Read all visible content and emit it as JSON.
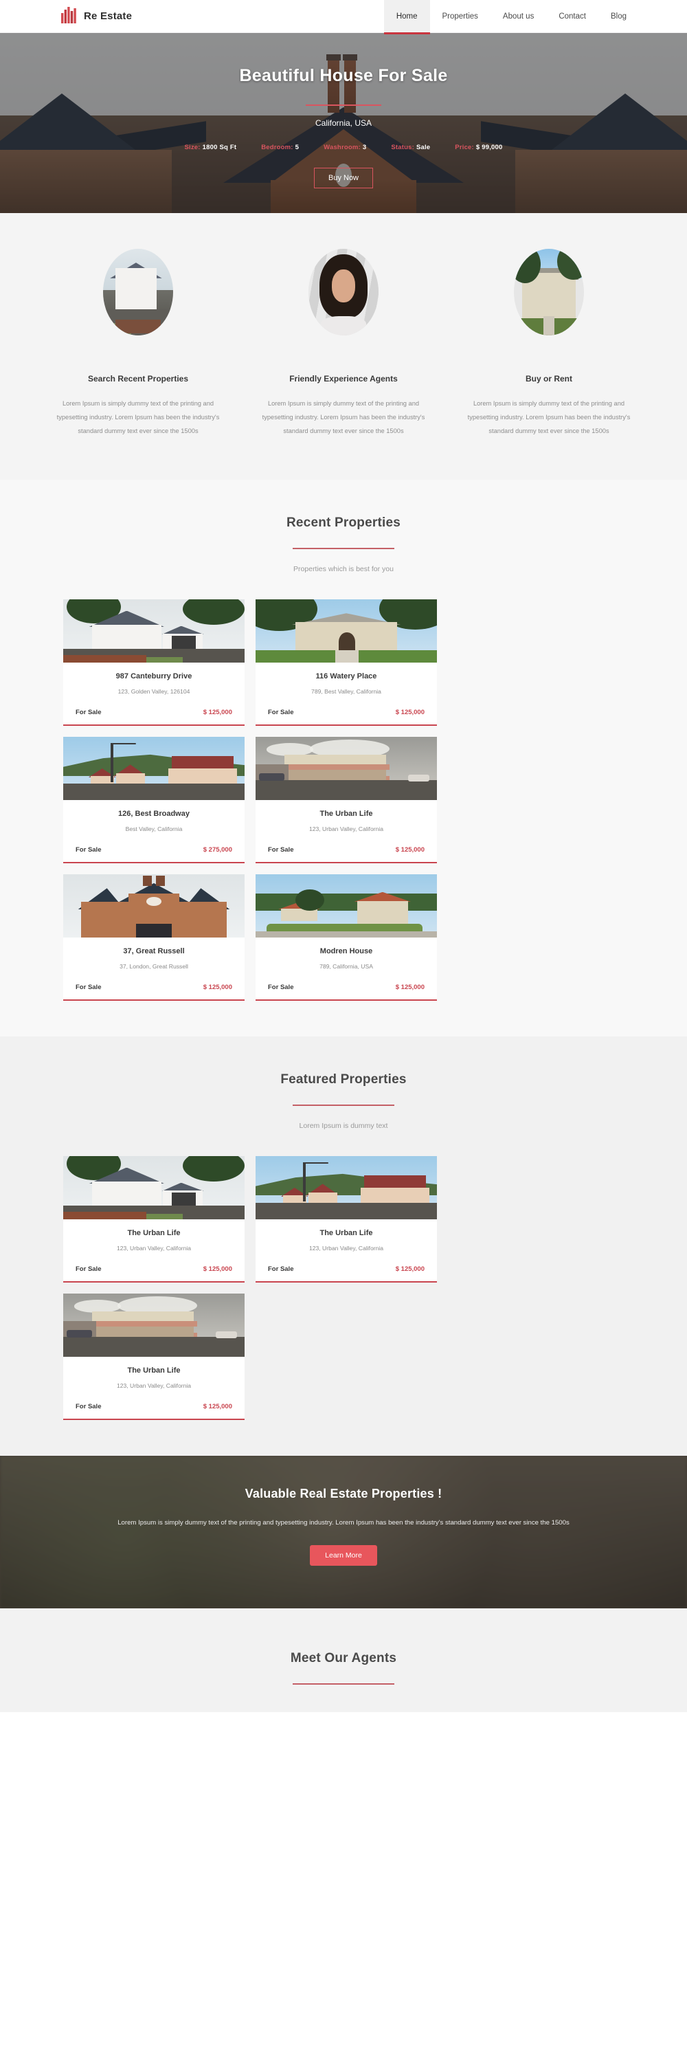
{
  "header": {
    "brand_name": "Re Estate",
    "logo_icon": "building-bars-icon",
    "nav": [
      {
        "label": "Home",
        "active": true
      },
      {
        "label": "Properties",
        "active": false
      },
      {
        "label": "About us",
        "active": false
      },
      {
        "label": "Contact",
        "active": false
      },
      {
        "label": "Blog",
        "active": false
      }
    ]
  },
  "hero": {
    "title": "Beautiful House For Sale",
    "location": "California, USA",
    "stats": [
      {
        "label": "Size:",
        "value": "1800 Sq Ft"
      },
      {
        "label": "Bedroom:",
        "value": "5"
      },
      {
        "label": "Washroom:",
        "value": "3"
      },
      {
        "label": "Status:",
        "value": "Sale"
      },
      {
        "label": "Price:",
        "value": "$ 99,000"
      }
    ],
    "button_label": "Buy Now"
  },
  "features": [
    {
      "title": "Search Recent Properties",
      "text": "Lorem Ipsum is simply dummy text of the printing and typesetting industry. Lorem Ipsum has been the industry's standard dummy text ever since the 1500s",
      "image": "white-house-photo"
    },
    {
      "title": "Friendly Experience Agents",
      "text": "Lorem Ipsum is simply dummy text of the printing and typesetting industry. Lorem Ipsum has been the industry's standard dummy text ever since the 1500s",
      "image": "agent-portrait-photo"
    },
    {
      "title": "Buy or Rent",
      "text": "Lorem Ipsum is simply dummy text of the printing and typesetting industry. Lorem Ipsum has been the industry's standard dummy text ever since the 1500s",
      "image": "mansion-photo"
    }
  ],
  "recent": {
    "title": "Recent Properties",
    "subtitle": "Properties which is best for you",
    "cards": [
      {
        "title": "987 Canteburry Drive",
        "address": "123, Golden Valley, 126104",
        "status": "For Sale",
        "price": "$ 125,000",
        "image": "white-house-garage-photo"
      },
      {
        "title": "116 Watery Place",
        "address": "789, Best Valley, California",
        "status": "For Sale",
        "price": "$ 125,000",
        "image": "beige-mansion-photo"
      },
      {
        "title": "126, Best Broadway",
        "address": "Best Valley, California",
        "status": "For Sale",
        "price": "$ 275,000",
        "image": "red-roof-cottages-photo"
      },
      {
        "title": "The Urban Life",
        "address": "123, Urban Valley, California",
        "status": "For Sale",
        "price": "$ 125,000",
        "image": "corner-store-photo"
      },
      {
        "title": "37, Great Russell",
        "address": "37, London, Great Russell",
        "status": "For Sale",
        "price": "$ 125,000",
        "image": "brick-townhouse-photo"
      },
      {
        "title": "Modren House",
        "address": "789, California, USA",
        "status": "For Sale",
        "price": "$ 125,000",
        "image": "villa-hedge-photo"
      }
    ]
  },
  "featured": {
    "title": "Featured Properties",
    "subtitle": "Lorem Ipsum is dummy text",
    "cards": [
      {
        "title": "The Urban Life",
        "address": "123, Urban Valley, California",
        "status": "For Sale",
        "price": "$ 125,000",
        "image": "white-house-garage-photo"
      },
      {
        "title": "The Urban Life",
        "address": "123, Urban Valley, California",
        "status": "For Sale",
        "price": "$ 125,000",
        "image": "red-roof-cottages-photo"
      },
      {
        "title": "The Urban Life",
        "address": "123, Urban Valley, California",
        "status": "For Sale",
        "price": "$ 125,000",
        "image": "corner-store-photo"
      }
    ]
  },
  "cta": {
    "title": "Valuable Real Estate Properties !",
    "text": "Lorem Ipsum is simply dummy text of the printing and typesetting industry. Lorem Ipsum has been the industry's standard dummy text ever since the 1500s",
    "button_label": "Learn More"
  },
  "agents": {
    "title": "Meet Our Agents"
  },
  "colors": {
    "accent_red": "#c9454f",
    "button_red": "#e8565c",
    "divider_red": "#c46067",
    "text_dark": "#3a3a3a",
    "text_muted": "#8d8d8d",
    "bg_light": "#f4f4f4"
  }
}
